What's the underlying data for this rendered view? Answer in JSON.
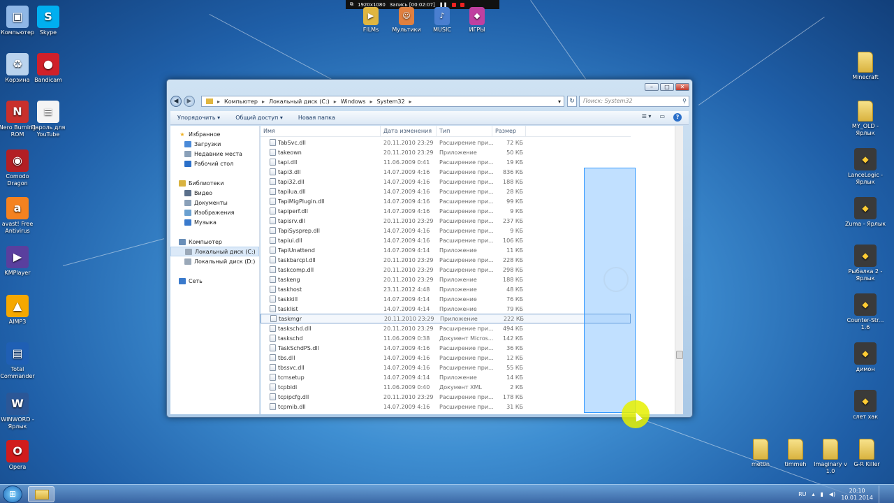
{
  "recorder": {
    "resolution": "1920x1080",
    "status": "Запись [00:02:07]"
  },
  "desktop": {
    "left_icons": [
      {
        "label": "Компьютер",
        "icon": "computer-icon",
        "color": "#8fb7e6"
      },
      {
        "label": "Skype",
        "icon": "skype-icon",
        "color": "#00aff0"
      },
      {
        "label": "Корзина",
        "icon": "recycle-bin-icon",
        "color": "#b9d3ee"
      },
      {
        "label": "Bandicam",
        "icon": "bandicam-icon",
        "color": "#d0202a"
      },
      {
        "label": "Nero Burning ROM",
        "icon": "nero-icon",
        "color": "#c9302c"
      },
      {
        "label": "Пароль для YouTube",
        "icon": "text-file-icon",
        "color": "#f4f4f4"
      },
      {
        "label": "Comodo Dragon",
        "icon": "comodo-dragon-icon",
        "color": "#b31f24"
      },
      {
        "label": "avast! Free Antivirus",
        "icon": "avast-icon",
        "color": "#f58220"
      },
      {
        "label": "KMPlayer",
        "icon": "kmplayer-icon",
        "color": "#5a3f9e"
      },
      {
        "label": "AIMP3",
        "icon": "aimp-icon",
        "color": "#f6a800"
      },
      {
        "label": "Total Commander",
        "icon": "total-commander-icon",
        "color": "#1f5fb4"
      },
      {
        "label": "WINWORD - Ярлык",
        "icon": "word-icon",
        "color": "#2b5797"
      },
      {
        "label": "Opera",
        "icon": "opera-icon",
        "color": "#d11c1c"
      }
    ],
    "top_icons": [
      {
        "label": "FILMs",
        "icon": "film-folder-icon",
        "color": "#e0b640"
      },
      {
        "label": "Мультики",
        "icon": "cartoons-folder-icon",
        "color": "#e08040"
      },
      {
        "label": "MUSIC",
        "icon": "music-folder-icon",
        "color": "#4a7fd0"
      },
      {
        "label": "ИГРЫ",
        "icon": "games-folder-icon",
        "color": "#c040a0"
      }
    ],
    "right_icons": [
      {
        "label": "Minecraft",
        "icon": "folder-icon"
      },
      {
        "label": "MY_OLD - Ярлык",
        "icon": "folder-icon"
      },
      {
        "label": "LanceLogic - Ярлык",
        "icon": "lancelogic-icon"
      },
      {
        "label": "Zuma - Ярлык",
        "icon": "zuma-icon"
      },
      {
        "label": "Рыбалка 2 - Ярлык",
        "icon": "fishing-icon"
      },
      {
        "label": "Counter-Str... 1.6",
        "icon": "counter-strike-icon"
      },
      {
        "label": "димон",
        "icon": "cs-dimon-icon"
      },
      {
        "label": "слет хак",
        "icon": "counter-strike-icon"
      }
    ],
    "bottom_folders": [
      "met0n",
      "timmeh",
      "Imaginary v 1.0",
      "G-R Killer"
    ]
  },
  "explorer": {
    "address": [
      "Компьютер",
      "Локальный диск (C:)",
      "Windows",
      "System32"
    ],
    "search_placeholder": "Поиск: System32",
    "toolbar": {
      "organize": "Упорядочить",
      "share": "Общий доступ",
      "new_folder": "Новая папка"
    },
    "nav": [
      {
        "label": "Избранное",
        "icon": "star-icon",
        "indent": 0
      },
      {
        "label": "Загрузки",
        "icon": "downloads-icon",
        "indent": 1
      },
      {
        "label": "Недавние места",
        "icon": "recent-places-icon",
        "indent": 1
      },
      {
        "label": "Рабочий стол",
        "icon": "desktop-icon",
        "indent": 1
      },
      {
        "label": "",
        "icon": "",
        "indent": 0
      },
      {
        "label": "Библиотеки",
        "icon": "libraries-icon",
        "indent": 0
      },
      {
        "label": "Видео",
        "icon": "video-icon",
        "indent": 1
      },
      {
        "label": "Документы",
        "icon": "documents-icon",
        "indent": 1
      },
      {
        "label": "Изображения",
        "icon": "images-icon",
        "indent": 1
      },
      {
        "label": "Музыка",
        "icon": "music-icon",
        "indent": 1
      },
      {
        "label": "",
        "icon": "",
        "indent": 0
      },
      {
        "label": "Компьютер",
        "icon": "computer-icon",
        "indent": 0
      },
      {
        "label": "Локальный диск (C:)",
        "icon": "drive-icon",
        "indent": 1,
        "selected": true
      },
      {
        "label": "Локальный диск (D:)",
        "icon": "drive-icon",
        "indent": 1
      },
      {
        "label": "",
        "icon": "",
        "indent": 0
      },
      {
        "label": "Сеть",
        "icon": "network-icon",
        "indent": 0
      }
    ],
    "columns": {
      "name": "Имя",
      "date": "Дата изменения",
      "type": "Тип",
      "size": "Размер"
    },
    "files": [
      {
        "name": "TabSvc.dll",
        "date": "20.11.2010 23:29",
        "type": "Расширение при...",
        "size": "72 КБ"
      },
      {
        "name": "takeown",
        "date": "20.11.2010 23:29",
        "type": "Приложение",
        "size": "50 КБ"
      },
      {
        "name": "tapi.dll",
        "date": "11.06.2009 0:41",
        "type": "Расширение при...",
        "size": "19 КБ"
      },
      {
        "name": "tapi3.dll",
        "date": "14.07.2009 4:16",
        "type": "Расширение при...",
        "size": "836 КБ"
      },
      {
        "name": "tapi32.dll",
        "date": "14.07.2009 4:16",
        "type": "Расширение при...",
        "size": "188 КБ"
      },
      {
        "name": "tapilua.dll",
        "date": "14.07.2009 4:16",
        "type": "Расширение при...",
        "size": "28 КБ"
      },
      {
        "name": "TapiMigPlugin.dll",
        "date": "14.07.2009 4:16",
        "type": "Расширение при...",
        "size": "99 КБ"
      },
      {
        "name": "tapiperf.dll",
        "date": "14.07.2009 4:16",
        "type": "Расширение при...",
        "size": "9 КБ"
      },
      {
        "name": "tapisrv.dll",
        "date": "20.11.2010 23:29",
        "type": "Расширение при...",
        "size": "237 КБ"
      },
      {
        "name": "TapiSysprep.dll",
        "date": "14.07.2009 4:16",
        "type": "Расширение при...",
        "size": "9 КБ"
      },
      {
        "name": "tapiui.dll",
        "date": "14.07.2009 4:16",
        "type": "Расширение при...",
        "size": "106 КБ"
      },
      {
        "name": "TapiUnattend",
        "date": "14.07.2009 4:14",
        "type": "Приложение",
        "size": "11 КБ"
      },
      {
        "name": "taskbarcpl.dll",
        "date": "20.11.2010 23:29",
        "type": "Расширение при...",
        "size": "228 КБ"
      },
      {
        "name": "taskcomp.dll",
        "date": "20.11.2010 23:29",
        "type": "Расширение при...",
        "size": "298 КБ"
      },
      {
        "name": "taskeng",
        "date": "20.11.2010 23:29",
        "type": "Приложение",
        "size": "188 КБ"
      },
      {
        "name": "taskhost",
        "date": "23.11.2012 4:48",
        "type": "Приложение",
        "size": "48 КБ"
      },
      {
        "name": "taskkill",
        "date": "14.07.2009 4:14",
        "type": "Приложение",
        "size": "76 КБ"
      },
      {
        "name": "tasklist",
        "date": "14.07.2009 4:14",
        "type": "Приложение",
        "size": "79 КБ"
      },
      {
        "name": "taskmgr",
        "date": "20.11.2010 23:29",
        "type": "Приложение",
        "size": "222 КБ",
        "selected": true
      },
      {
        "name": "taskschd.dll",
        "date": "20.11.2010 23:29",
        "type": "Расширение при...",
        "size": "494 КБ"
      },
      {
        "name": "taskschd",
        "date": "11.06.2009 0:38",
        "type": "Документ Micros...",
        "size": "142 КБ"
      },
      {
        "name": "TaskSchdPS.dll",
        "date": "14.07.2009 4:16",
        "type": "Расширение при...",
        "size": "36 КБ"
      },
      {
        "name": "tbs.dll",
        "date": "14.07.2009 4:16",
        "type": "Расширение при...",
        "size": "12 КБ"
      },
      {
        "name": "tbssvc.dll",
        "date": "14.07.2009 4:16",
        "type": "Расширение при...",
        "size": "55 КБ"
      },
      {
        "name": "tcmsetup",
        "date": "14.07.2009 4:14",
        "type": "Приложение",
        "size": "14 КБ"
      },
      {
        "name": "tcpbidi",
        "date": "11.06.2009 0:40",
        "type": "Документ XML",
        "size": "2 КБ"
      },
      {
        "name": "tcpipcfg.dll",
        "date": "20.11.2010 23:29",
        "type": "Расширение при...",
        "size": "178 КБ"
      },
      {
        "name": "tcpmib.dll",
        "date": "14.07.2009 4:16",
        "type": "Расширение при...",
        "size": "31 КБ"
      }
    ]
  },
  "taskbar": {
    "language": "RU",
    "time": "20:10",
    "date": "10.01.2014"
  }
}
